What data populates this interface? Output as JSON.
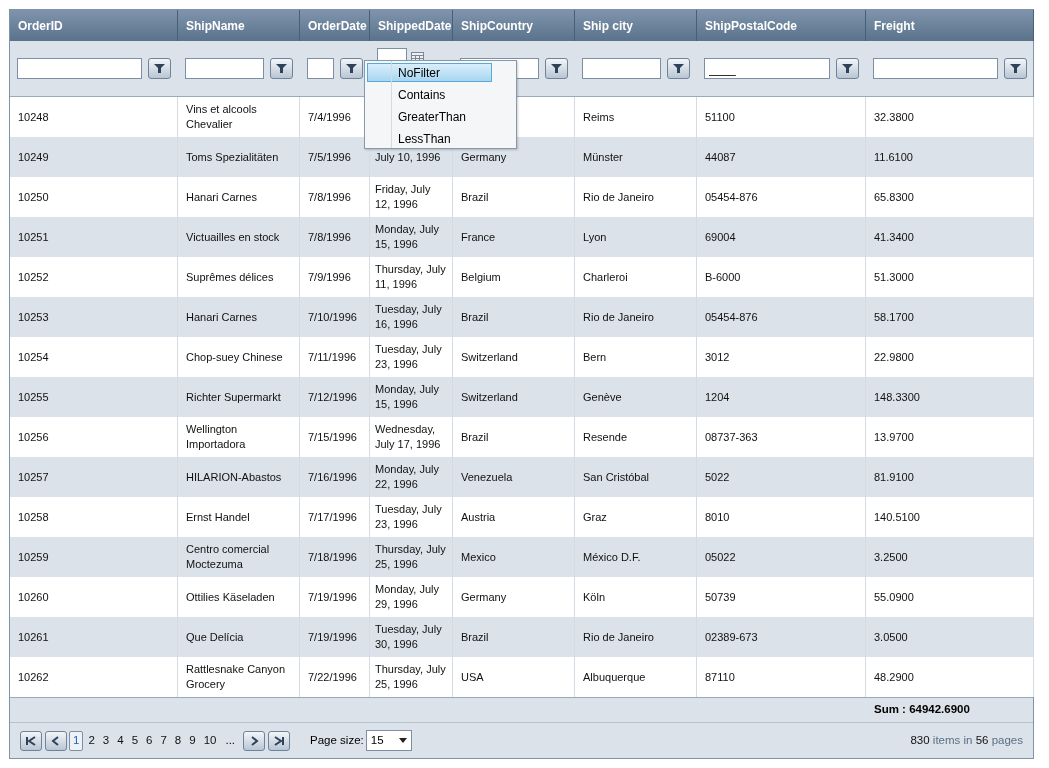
{
  "columns": [
    {
      "title": "OrderID",
      "filter": {
        "kind": "text"
      }
    },
    {
      "title": "ShipName",
      "filter": {
        "kind": "text"
      }
    },
    {
      "title": "OrderDate",
      "filter": {
        "kind": "text"
      }
    },
    {
      "title": "ShippedDate",
      "filter": {
        "kind": "date"
      }
    },
    {
      "title": "ShipCountry",
      "filter": {
        "kind": "text"
      }
    },
    {
      "title": "Ship city",
      "filter": {
        "kind": "text"
      }
    },
    {
      "title": "ShipPostalCode",
      "filter": {
        "kind": "text",
        "value": "____"
      }
    },
    {
      "title": "Freight",
      "filter": {
        "kind": "text"
      }
    }
  ],
  "filter_menu": {
    "items": [
      {
        "label": "NoFilter",
        "selected": true
      },
      {
        "label": "Contains",
        "selected": false
      },
      {
        "label": "GreaterThan",
        "selected": false
      },
      {
        "label": "LessThan",
        "selected": false
      }
    ]
  },
  "rows": [
    {
      "order_id": "10248",
      "ship_name": "Vins et alcools Chevalier",
      "order_date": "7/4/1996",
      "ship_city": "Reims",
      "ship_postal_code": "51100",
      "freight": "32.3800"
    },
    {
      "order_id": "10249",
      "ship_name": "Toms Spezialitäten",
      "order_date": "7/5/1996",
      "shipped_date": "July 10, 1996",
      "ship_country": "Germany",
      "ship_city": "Münster",
      "ship_postal_code": "44087",
      "freight": "11.6100"
    },
    {
      "order_id": "10250",
      "ship_name": "Hanari Carnes",
      "order_date": "7/8/1996",
      "shipped_date": "Friday, July 12, 1996",
      "ship_country": "Brazil",
      "ship_city": "Rio de Janeiro",
      "ship_postal_code": "05454-876",
      "freight": "65.8300"
    },
    {
      "order_id": "10251",
      "ship_name": "Victuailles en stock",
      "order_date": "7/8/1996",
      "shipped_date": "Monday, July 15, 1996",
      "ship_country": "France",
      "ship_city": "Lyon",
      "ship_postal_code": "69004",
      "freight": "41.3400"
    },
    {
      "order_id": "10252",
      "ship_name": "Suprêmes délices",
      "order_date": "7/9/1996",
      "shipped_date": "Thursday, July 11, 1996",
      "ship_country": "Belgium",
      "ship_city": "Charleroi",
      "ship_postal_code": "B-6000",
      "freight": "51.3000"
    },
    {
      "order_id": "10253",
      "ship_name": "Hanari Carnes",
      "order_date": "7/10/1996",
      "shipped_date": "Tuesday, July 16, 1996",
      "ship_country": "Brazil",
      "ship_city": "Rio de Janeiro",
      "ship_postal_code": "05454-876",
      "freight": "58.1700"
    },
    {
      "order_id": "10254",
      "ship_name": "Chop-suey Chinese",
      "order_date": "7/11/1996",
      "shipped_date": "Tuesday, July 23, 1996",
      "ship_country": "Switzerland",
      "ship_city": "Bern",
      "ship_postal_code": "3012",
      "freight": "22.9800"
    },
    {
      "order_id": "10255",
      "ship_name": "Richter Supermarkt",
      "order_date": "7/12/1996",
      "shipped_date": "Monday, July 15, 1996",
      "ship_country": "Switzerland",
      "ship_city": "Genève",
      "ship_postal_code": "1204",
      "freight": "148.3300"
    },
    {
      "order_id": "10256",
      "ship_name": "Wellington Importadora",
      "order_date": "7/15/1996",
      "shipped_date": "Wednesday, July 17, 1996",
      "ship_country": "Brazil",
      "ship_city": "Resende",
      "ship_postal_code": "08737-363",
      "freight": "13.9700"
    },
    {
      "order_id": "10257",
      "ship_name": "HILARION-Abastos",
      "order_date": "7/16/1996",
      "shipped_date": "Monday, July 22, 1996",
      "ship_country": "Venezuela",
      "ship_city": "San Cristóbal",
      "ship_postal_code": "5022",
      "freight": "81.9100"
    },
    {
      "order_id": "10258",
      "ship_name": "Ernst Handel",
      "order_date": "7/17/1996",
      "shipped_date": "Tuesday, July 23, 1996",
      "ship_country": "Austria",
      "ship_city": "Graz",
      "ship_postal_code": "8010",
      "freight": "140.5100"
    },
    {
      "order_id": "10259",
      "ship_name": "Centro comercial Moctezuma",
      "order_date": "7/18/1996",
      "shipped_date": "Thursday, July 25, 1996",
      "ship_country": "Mexico",
      "ship_city": "México D.F.",
      "ship_postal_code": "05022",
      "freight": "3.2500"
    },
    {
      "order_id": "10260",
      "ship_name": "Ottilies Käseladen",
      "order_date": "7/19/1996",
      "shipped_date": "Monday, July 29, 1996",
      "ship_country": "Germany",
      "ship_city": "Köln",
      "ship_postal_code": "50739",
      "freight": "55.0900"
    },
    {
      "order_id": "10261",
      "ship_name": "Que Delícia",
      "order_date": "7/19/1996",
      "shipped_date": "Tuesday, July 30, 1996",
      "ship_country": "Brazil",
      "ship_city": "Rio de Janeiro",
      "ship_postal_code": "02389-673",
      "freight": "3.0500"
    },
    {
      "order_id": "10262",
      "ship_name": "Rattlesnake Canyon Grocery",
      "order_date": "7/22/1996",
      "shipped_date": "Thursday, July 25, 1996",
      "ship_country": "USA",
      "ship_city": "Albuquerque",
      "ship_postal_code": "87110",
      "freight": "48.2900"
    }
  ],
  "footer": {
    "sum": "Sum : 64942.6900"
  },
  "pager": {
    "pages": [
      {
        "label": "1",
        "selected": true
      },
      {
        "label": "2",
        "selected": false
      },
      {
        "label": "3",
        "selected": false
      },
      {
        "label": "4",
        "selected": false
      },
      {
        "label": "5",
        "selected": false
      },
      {
        "label": "6",
        "selected": false
      },
      {
        "label": "7",
        "selected": false
      },
      {
        "label": "8",
        "selected": false
      },
      {
        "label": "9",
        "selected": false
      },
      {
        "label": "10",
        "selected": false
      }
    ],
    "more": "...",
    "page_size_label": "Page size:",
    "page_size": "15",
    "summary": "**830** items in **56** pages"
  }
}
